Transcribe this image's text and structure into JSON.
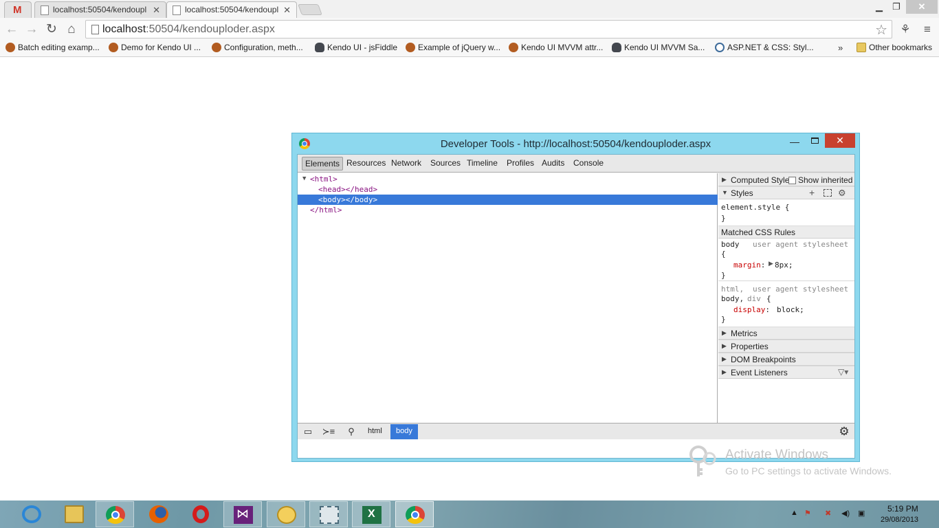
{
  "browser": {
    "tabs": [
      {
        "title": "localhost:50504/kendoupl"
      },
      {
        "title": "localhost:50504/kendoupl"
      }
    ],
    "address": {
      "host": "localhost",
      "path": ":50504/kendouploder.aspx"
    },
    "bookmarks": [
      {
        "label": "Batch editing examp...",
        "icon": "kendo"
      },
      {
        "label": "Demo for Kendo UI ...",
        "icon": "kendo"
      },
      {
        "label": "Configuration, meth...",
        "icon": "kendo"
      },
      {
        "label": "Kendo UI - jsFiddle",
        "icon": "fiddle"
      },
      {
        "label": "Example of jQuery w...",
        "icon": "kendo"
      },
      {
        "label": "Kendo UI MVVM attr...",
        "icon": "kendo"
      },
      {
        "label": "Kendo UI MVVM Sa...",
        "icon": "fiddle"
      },
      {
        "label": "ASP.NET & CSS: Styl...",
        "icon": "wordpress"
      }
    ],
    "bookmarks_overflow": "»",
    "other_bookmarks": "Other bookmarks"
  },
  "devtools": {
    "title": "Developer Tools - http://localhost:50504/kendouploder.aspx",
    "tabs": [
      "Elements",
      "Resources",
      "Network",
      "Sources",
      "Timeline",
      "Profiles",
      "Audits",
      "Console"
    ],
    "selected_tab": "Elements",
    "dom": {
      "line1": "<html>",
      "line2": "<head></head>",
      "line3": "<body></body>",
      "line4": "</html>"
    },
    "sidebar": {
      "computed_style": "Computed Style",
      "show_inherited": "Show inherited",
      "styles": "Styles",
      "element_style": "element.style {",
      "close_brace": "}",
      "matched_rules": "Matched CSS Rules",
      "rule1_selector": "body",
      "rule1_source": "user agent stylesheet",
      "rule1_open": "{",
      "rule1_prop": "margin",
      "rule1_value": "8px;",
      "rule2_selector": "html,",
      "rule2_source": "user agent stylesheet",
      "rule2_selector2a": "body,",
      "rule2_selector2b": "div",
      "rule2_open": "{",
      "rule2_prop": "display",
      "rule2_value": "block;",
      "metrics": "Metrics",
      "properties": "Properties",
      "dom_breakpoints": "DOM Breakpoints",
      "event_listeners": "Event Listeners"
    },
    "breadcrumbs": [
      "html",
      "body"
    ]
  },
  "watermark": {
    "line1": "Activate Windows",
    "line2": "Go to PC settings to activate Windows."
  },
  "taskbar": {
    "time": "5:19 PM",
    "date": "29/08/2013"
  }
}
